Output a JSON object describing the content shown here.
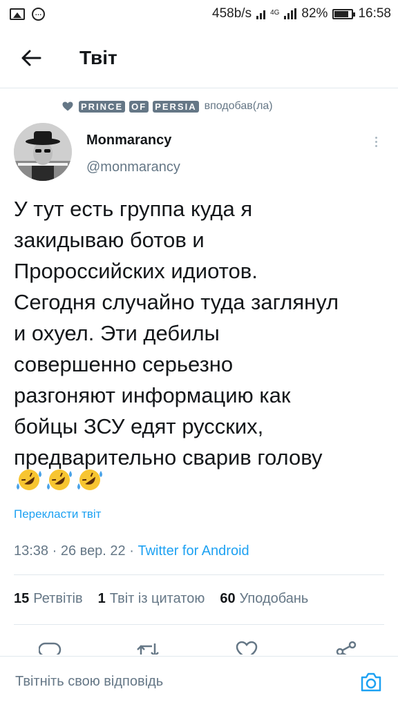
{
  "status_bar": {
    "speed": "458b/s",
    "network": "4G",
    "battery": "82%",
    "time": "16:58",
    "icons": [
      "image-icon",
      "chat-icon",
      "wifi-signal-icon",
      "cell-signal-icon",
      "battery-icon"
    ]
  },
  "header": {
    "title": "Твіт"
  },
  "social_context": {
    "liker_words": [
      "PRINCE",
      "OF",
      "PERSIA"
    ],
    "action": "вподобав(ла)"
  },
  "tweet": {
    "author_name": "Monmarancy",
    "author_handle": "@monmarancy",
    "text": "У тут есть группа куда я\nзакидываю ботов и\nПророссийских идиотов.\nСегодня случайно туда заглянул\nи охуел. Эти дебилы\nсовершенно серьезно\nразгоняют информацию как\nбойцы ЗСУ едят русских,\nпредварительно сварив голову",
    "emojis": [
      "rolling-on-floor-laughing",
      "rolling-on-floor-laughing",
      "rolling-on-floor-laughing"
    ],
    "translate_label": "Перекласти твіт",
    "time": "13:38",
    "date": "26 вер. 22",
    "separator": "·",
    "source": "Twitter for Android"
  },
  "stats": {
    "retweets_count": "15",
    "retweets_label": "Ретвітів",
    "quotes_count": "1",
    "quotes_label": "Твіт із цитатою",
    "likes_count": "60",
    "likes_label": "Уподобань"
  },
  "reply": {
    "placeholder": "Твітніть свою відповідь"
  },
  "colors": {
    "accent": "#1da1f2",
    "text_primary": "#14171a",
    "text_secondary": "#657786",
    "divider": "#e1e8ed"
  }
}
